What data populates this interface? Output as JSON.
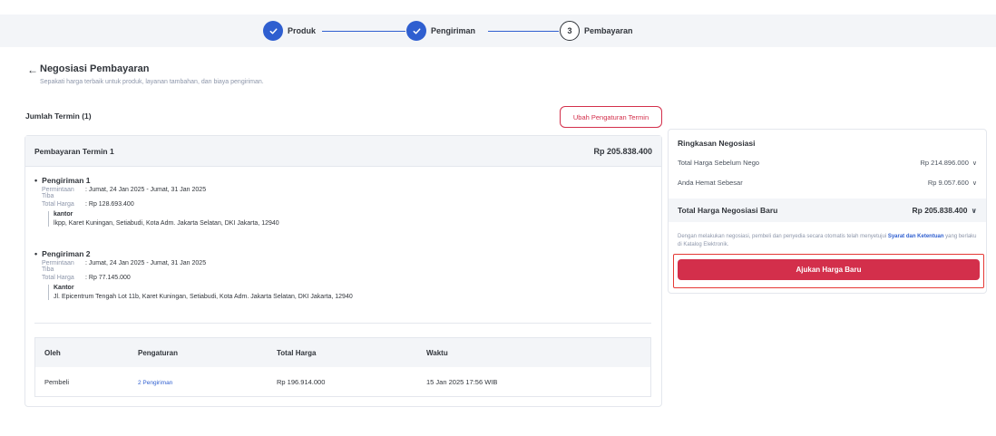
{
  "stepper": {
    "steps": [
      {
        "label": "Produk",
        "status": "done"
      },
      {
        "label": "Pengiriman",
        "status": "done"
      },
      {
        "label": "Pembayaran",
        "status": "active",
        "number": "3"
      }
    ]
  },
  "header": {
    "title": "Negosiasi Pembayaran",
    "subtitle": "Sepakati harga terbaik untuk produk, layanan tambahan, dan biaya pengiriman."
  },
  "termin": {
    "count_label": "Jumlah Termin (1)",
    "change_button": "Ubah Pengaturan Termin",
    "card_title": "Pembayaran Termin 1",
    "card_amount": "Rp 205.838.400",
    "shipments": [
      {
        "title": "Pengiriman 1",
        "request_label": "Permintaan Tiba",
        "request_value": ": Jumat, 24 Jan 2025 - Jumat, 31 Jan 2025",
        "price_label": "Total Harga",
        "price_value": ": Rp 128.693.400",
        "address_name": "kantor",
        "address_line": "lkpp, Karet Kuningan, Setiabudi, Kota Adm. Jakarta Selatan, DKI Jakarta, 12940"
      },
      {
        "title": "Pengiriman 2",
        "request_label": "Permintaan Tiba",
        "request_value": ": Jumat, 24 Jan 2025 - Jumat, 31 Jan 2025",
        "price_label": "Total Harga",
        "price_value": ": Rp 77.145.000",
        "address_name": "Kantor",
        "address_line": "Jl. Epicentrum Tengah Lot 11b, Karet Kuningan, Setiabudi, Kota Adm. Jakarta Selatan, DKI Jakarta, 12940"
      }
    ],
    "history": {
      "headers": [
        "Oleh",
        "Pengaturan",
        "Total Harga",
        "Waktu"
      ],
      "rows": [
        {
          "by": "Pembeli",
          "setting": "2 Pengiriman",
          "total": "Rp 196.914.000",
          "time": "15 Jan 2025 17:56 WIB"
        }
      ]
    }
  },
  "summary": {
    "title": "Ringkasan Negosiasi",
    "before_label": "Total Harga Sebelum Nego",
    "before_value": "Rp 214.896.000",
    "saving_label": "Anda Hemat Sebesar",
    "saving_value": "Rp 9.057.600",
    "total_label": "Total Harga Negosiasi Baru",
    "total_value": "Rp 205.838.400",
    "disclaimer_pre": "Dengan melakukan negosiasi, pembeli dan penyedia secara otomatis telah menyetujui ",
    "disclaimer_link": "Syarat dan Ketentuan",
    "disclaimer_post": " yang berlaku di Katalog Elektronik.",
    "submit_button": "Ajukan Harga Baru"
  },
  "colors": {
    "primary_blue": "#2f5fd0",
    "danger_red": "#d32f4b",
    "highlight_red": "#e53935"
  }
}
